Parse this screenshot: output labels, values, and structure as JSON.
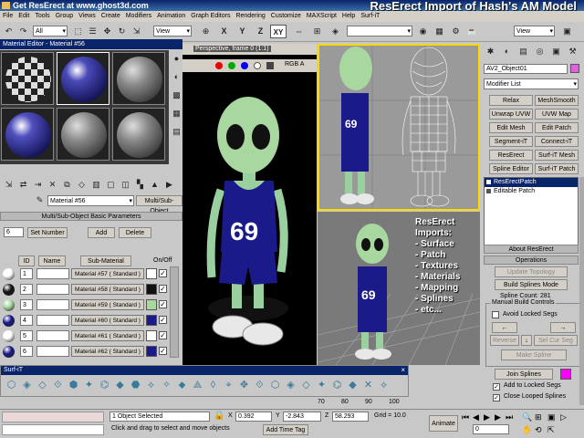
{
  "window": {
    "title": "Get ResErect at www.ghost3d.com",
    "overlay_title": "ResErect Import of Hash's AM Model"
  },
  "menu": [
    "File",
    "Edit",
    "Tools",
    "Group",
    "Views",
    "Create",
    "Modifiers",
    "Animation",
    "Graph Editors",
    "Rendering",
    "Customize",
    "MAXScript",
    "Help",
    "Surf-iT"
  ],
  "toolbar": {
    "selection_filter": "All",
    "view_dropdown": "View",
    "axis_x": "X",
    "axis_y": "Y",
    "axis_z": "Z",
    "axis_xy": "XY",
    "view_dropdown_right": "View"
  },
  "material_editor": {
    "title": "Material Editor - Material #56",
    "material_name": "Material #56",
    "material_type": "Multi/Sub-Object",
    "rollout_title": "Multi/Sub-Object Basic Parameters",
    "count": "6",
    "set_number": "Set Number",
    "add": "Add",
    "delete": "Delete",
    "headers": {
      "id": "ID",
      "name": "Name",
      "sub": "Sub-Material",
      "onoff": "On/Off"
    },
    "rows": [
      {
        "id": "1",
        "sub": "Material #57  ( Standard )",
        "color": "#ffffff"
      },
      {
        "id": "2",
        "sub": "Material #58  ( Standard )",
        "color": "#111111"
      },
      {
        "id": "3",
        "sub": "Material #59  ( Standard )",
        "color": "#a8d8a0"
      },
      {
        "id": "4",
        "sub": "Material #60  ( Standard )",
        "color": "#1a1a8a"
      },
      {
        "id": "5",
        "sub": "Material #61  ( Standard )",
        "color": "#ffffff"
      },
      {
        "id": "6",
        "sub": "Material #62  ( Standard )",
        "color": "#1a1a8a"
      }
    ]
  },
  "viewports": {
    "perspective_label": "Perspective, frame 0 (1:1)",
    "rgb_label": "RGB A",
    "info_lines": [
      "ResErect",
      "Imports:",
      "- Surface",
      "- Patch",
      "- Textures",
      "- Materials",
      "- Mapping",
      "- Splines",
      "- etc..."
    ],
    "ruler_ticks": [
      "70",
      "80",
      "90",
      "100"
    ]
  },
  "command_panel": {
    "object_name": "AV2_Object01",
    "modifier_list": "Modifier List",
    "buttons": [
      [
        "Relax",
        "MeshSmooth"
      ],
      [
        "Unwrap UVW",
        "UVW Map"
      ],
      [
        "Edit Mesh",
        "Edit Patch"
      ],
      [
        "Segment-iT",
        "Connect-iT"
      ],
      [
        "ResErect",
        "Surf-iT Mesh"
      ],
      [
        "Spline Editor",
        "Surf-iT Patch"
      ]
    ],
    "stack": [
      "ResErectPatch",
      "Editable Patch"
    ],
    "about_rollout": "About ResErect",
    "operations_rollout": "Operations",
    "update_topology": "Update Topology",
    "build_splines": "Build Splines Mode",
    "spline_count": "Spline Count: 281",
    "manual_build": "Manual Build Controls",
    "avoid_locked": "Avoid Locked Segs",
    "reverse": "Reverse",
    "sel_cur_seg": "Sel Cur Seg",
    "make_spline": "Make Spline",
    "join_splines": "Join Splines",
    "add_locked": "Add to Locked Segs",
    "close_looped": "Close Looped Splines"
  },
  "surfit": {
    "title": "Surf-iT"
  },
  "status": {
    "selected": "1 Object Selected",
    "prompt": "Click and drag to select and move objects",
    "x_label": "X",
    "x_value": "0.392",
    "y_label": "Y",
    "y_value": "-2.843",
    "z_label": "Z",
    "z_value": "58.293",
    "grid": "Grid = 10.0",
    "add_time_tag": "Add Time Tag",
    "animate": "Animate",
    "frame": "0"
  },
  "colors": {
    "accent": "#ffd800",
    "titlebar": "#0a246a",
    "shirt": "#1a1a8a",
    "skin": "#a8d8a0"
  }
}
